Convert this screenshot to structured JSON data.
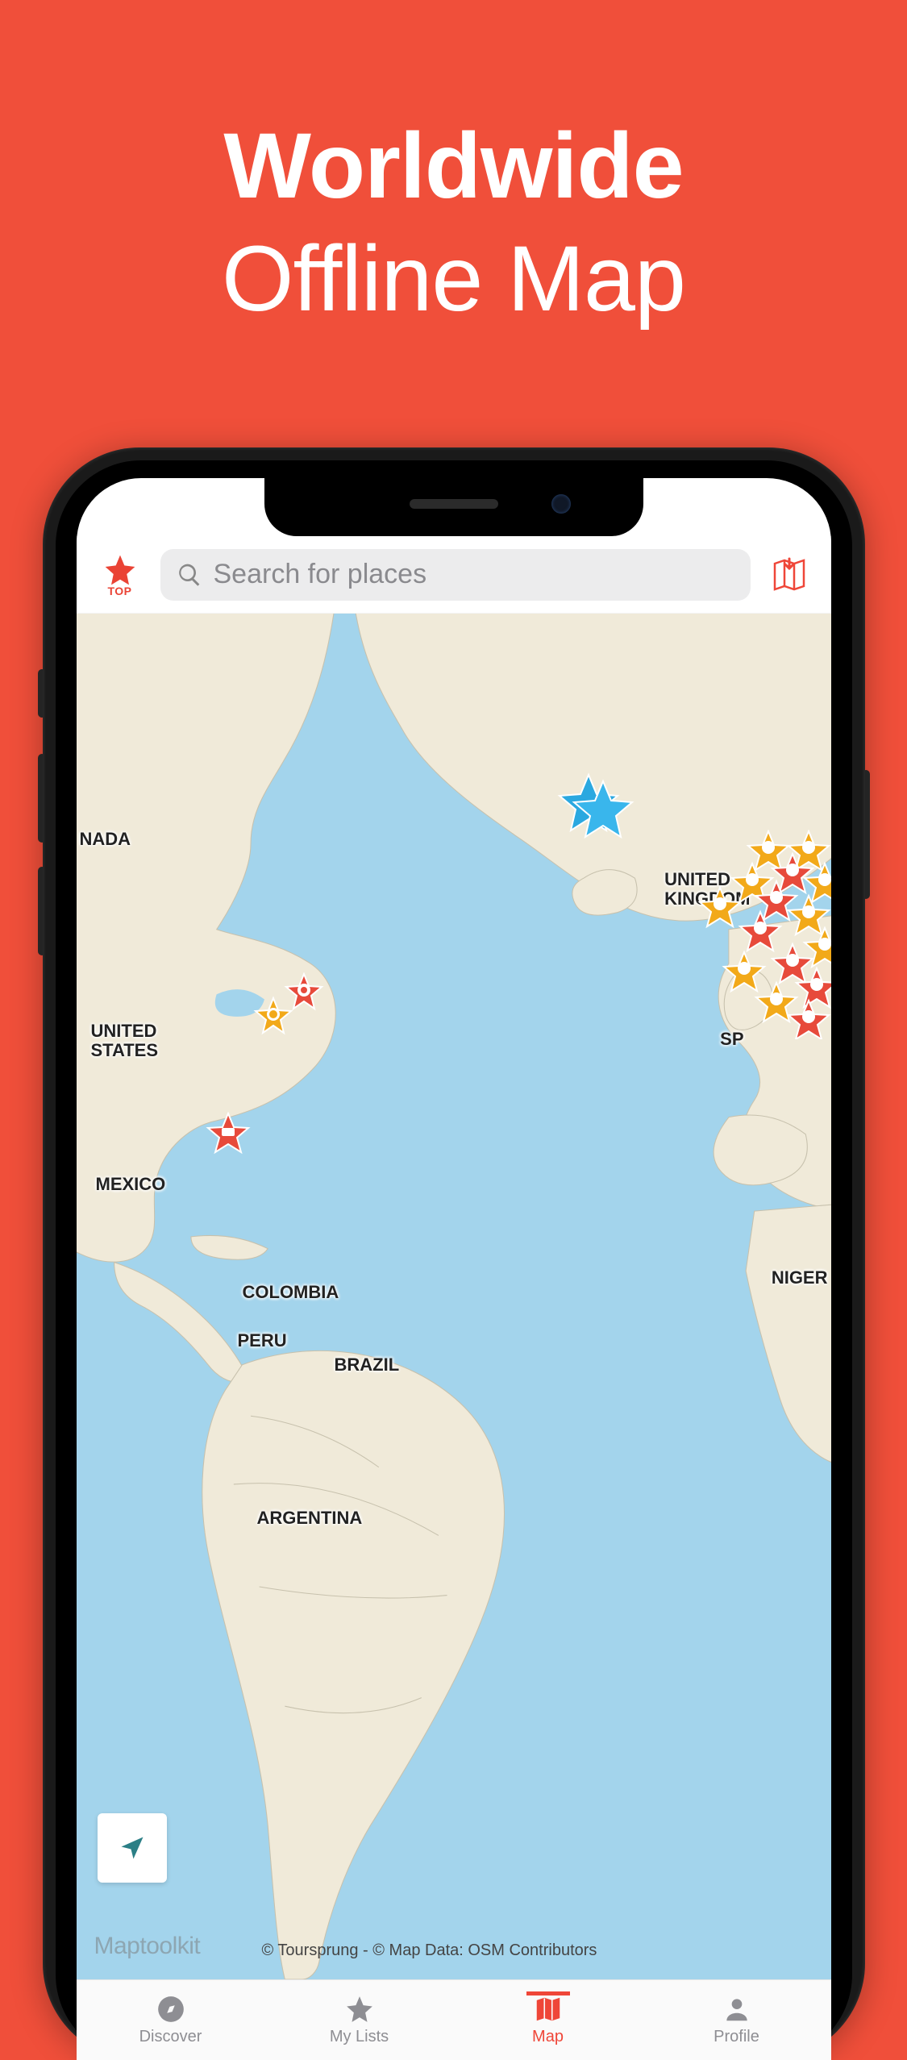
{
  "headline": {
    "line1": "Worldwide",
    "line2": "Offline Map"
  },
  "appbar": {
    "top_label": "TOP",
    "search_placeholder": "Search for places"
  },
  "map": {
    "labels": {
      "canada": "NADA",
      "us": "UNITED\nSTATES",
      "uk": "UNITED\nKINGDOM",
      "spain": "SP",
      "mexico": "MEXICO",
      "colombia": "COLOMBIA",
      "peru": "PERU",
      "brazil": "BRAZIL",
      "argentina": "ARGENTINA",
      "nigeria": "NIGER"
    },
    "watermark": "Maptoolkit",
    "attribution": "© Toursprung - © Map Data: OSM Contributors"
  },
  "tabs": {
    "discover": "Discover",
    "mylists": "My Lists",
    "map": "Map",
    "profile": "Profile"
  },
  "colors": {
    "accent": "#ef4638",
    "background": "#f04f3a",
    "water": "#a3d4ec",
    "land": "#f0ead9"
  }
}
